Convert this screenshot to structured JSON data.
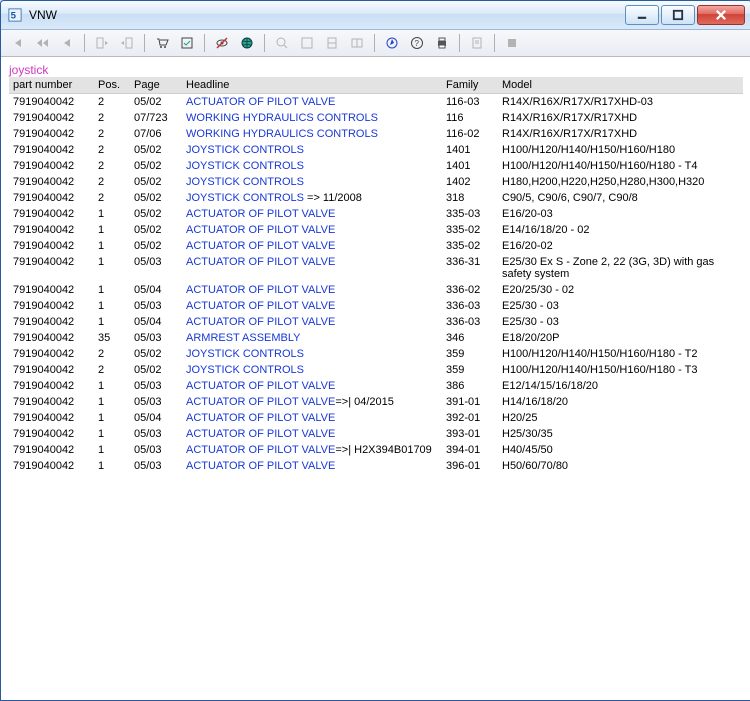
{
  "window": {
    "title": "VNW"
  },
  "caption": "joystick",
  "table": {
    "headers": {
      "partnumber": "part number",
      "pos": "Pos.",
      "page": "Page",
      "headline": "Headline",
      "family": "Family",
      "model": "Model"
    },
    "rows": [
      {
        "pn": "7919040042",
        "pos": "2",
        "page": "05/02",
        "head": "ACTUATOR OF PILOT VALVE",
        "suffix": "",
        "fam": "116-03",
        "model": "R14X/R16X/R17X/R17XHD-03"
      },
      {
        "pn": "7919040042",
        "pos": "2",
        "page": "07/723",
        "head": "WORKING HYDRAULICS CONTROLS",
        "suffix": "",
        "fam": "116",
        "model": "R14X/R16X/R17X/R17XHD"
      },
      {
        "pn": "7919040042",
        "pos": "2",
        "page": "07/06",
        "head": "WORKING HYDRAULICS CONTROLS",
        "suffix": "",
        "fam": "116-02",
        "model": "R14X/R16X/R17X/R17XHD"
      },
      {
        "pn": "7919040042",
        "pos": "2",
        "page": "05/02",
        "head": "JOYSTICK CONTROLS",
        "suffix": "",
        "fam": "1401",
        "model": "H100/H120/H140/H150/H160/H180"
      },
      {
        "pn": "7919040042",
        "pos": "2",
        "page": "05/02",
        "head": "JOYSTICK CONTROLS",
        "suffix": "",
        "fam": "1401",
        "model": "H100/H120/H140/H150/H160/H180 - T4"
      },
      {
        "pn": "7919040042",
        "pos": "2",
        "page": "05/02",
        "head": "JOYSTICK CONTROLS",
        "suffix": "",
        "fam": "1402",
        "model": "H180,H200,H220,H250,H280,H300,H320"
      },
      {
        "pn": "7919040042",
        "pos": "2",
        "page": "05/02",
        "head": "JOYSTICK CONTROLS",
        "suffix": "   => 11/2008",
        "fam": "318",
        "model": "C90/5, C90/6, C90/7, C90/8"
      },
      {
        "pn": "7919040042",
        "pos": "1",
        "page": "05/02",
        "head": "ACTUATOR OF PILOT VALVE",
        "suffix": "",
        "fam": "335-03",
        "model": "E16/20-03"
      },
      {
        "pn": "7919040042",
        "pos": "1",
        "page": "05/02",
        "head": "ACTUATOR OF PILOT VALVE",
        "suffix": "",
        "fam": "335-02",
        "model": "E14/16/18/20 - 02"
      },
      {
        "pn": "7919040042",
        "pos": "1",
        "page": "05/02",
        "head": "ACTUATOR OF PILOT VALVE",
        "suffix": "",
        "fam": "335-02",
        "model": "E16/20-02"
      },
      {
        "pn": "7919040042",
        "pos": "1",
        "page": "05/03",
        "head": "ACTUATOR OF PILOT VALVE",
        "suffix": "",
        "fam": "336-31",
        "model": "E25/30 Ex S - Zone 2, 22 (3G, 3D) with gas safety system"
      },
      {
        "pn": "7919040042",
        "pos": "1",
        "page": "05/04",
        "head": "ACTUATOR OF PILOT VALVE",
        "suffix": "",
        "fam": "336-02",
        "model": "E20/25/30 - 02"
      },
      {
        "pn": "7919040042",
        "pos": "1",
        "page": "05/03",
        "head": "ACTUATOR OF PILOT VALVE",
        "suffix": "",
        "fam": "336-03",
        "model": "E25/30 - 03"
      },
      {
        "pn": "7919040042",
        "pos": "1",
        "page": "05/04",
        "head": "ACTUATOR OF PILOT VALVE",
        "suffix": "",
        "fam": "336-03",
        "model": "E25/30 - 03"
      },
      {
        "pn": "7919040042",
        "pos": "35",
        "page": "05/03",
        "head": "ARMREST ASSEMBLY",
        "suffix": "",
        "fam": "346",
        "model": "E18/20/20P"
      },
      {
        "pn": "7919040042",
        "pos": "2",
        "page": "05/02",
        "head": "JOYSTICK CONTROLS",
        "suffix": "",
        "fam": "359",
        "model": "H100/H120/H140/H150/H160/H180 - T2"
      },
      {
        "pn": "7919040042",
        "pos": "2",
        "page": "05/02",
        "head": "JOYSTICK CONTROLS",
        "suffix": "",
        "fam": "359",
        "model": "H100/H120/H140/H150/H160/H180 - T3"
      },
      {
        "pn": "7919040042",
        "pos": "1",
        "page": "05/03",
        "head": "ACTUATOR OF PILOT VALVE",
        "suffix": "",
        "fam": "386",
        "model": "E12/14/15/16/18/20"
      },
      {
        "pn": "7919040042",
        "pos": "1",
        "page": "05/03",
        "head": "ACTUATOR OF PILOT VALVE",
        "suffix": "=>| 04/2015",
        "fam": "391-01",
        "model": "H14/16/18/20"
      },
      {
        "pn": "7919040042",
        "pos": "1",
        "page": "05/04",
        "head": "ACTUATOR OF PILOT VALVE",
        "suffix": "",
        "fam": "392-01",
        "model": "H20/25"
      },
      {
        "pn": "7919040042",
        "pos": "1",
        "page": "05/03",
        "head": "ACTUATOR OF PILOT VALVE",
        "suffix": "",
        "fam": "393-01",
        "model": "H25/30/35"
      },
      {
        "pn": "7919040042",
        "pos": "1",
        "page": "05/03",
        "head": "ACTUATOR OF PILOT VALVE",
        "suffix": "=>| H2X394B01709",
        "fam": "394-01",
        "model": "H40/45/50"
      },
      {
        "pn": "7919040042",
        "pos": "1",
        "page": "05/03",
        "head": "ACTUATOR OF PILOT VALVE",
        "suffix": "",
        "fam": "396-01",
        "model": "H50/60/70/80"
      }
    ]
  },
  "toolbar": {
    "icons": [
      "first-icon",
      "prev-fast-icon",
      "prev-icon",
      "sep",
      "bookmark-in-icon",
      "bookmark-out-icon",
      "sep",
      "cart-icon",
      "check-icon",
      "sep",
      "eye-off-icon",
      "globe-icon",
      "sep",
      "zoom-icon",
      "page-fit-icon",
      "page-width-icon",
      "page-reset-icon",
      "sep",
      "compass-icon",
      "help-icon",
      "print-icon",
      "sep",
      "notes-icon",
      "sep",
      "stop-icon"
    ]
  }
}
